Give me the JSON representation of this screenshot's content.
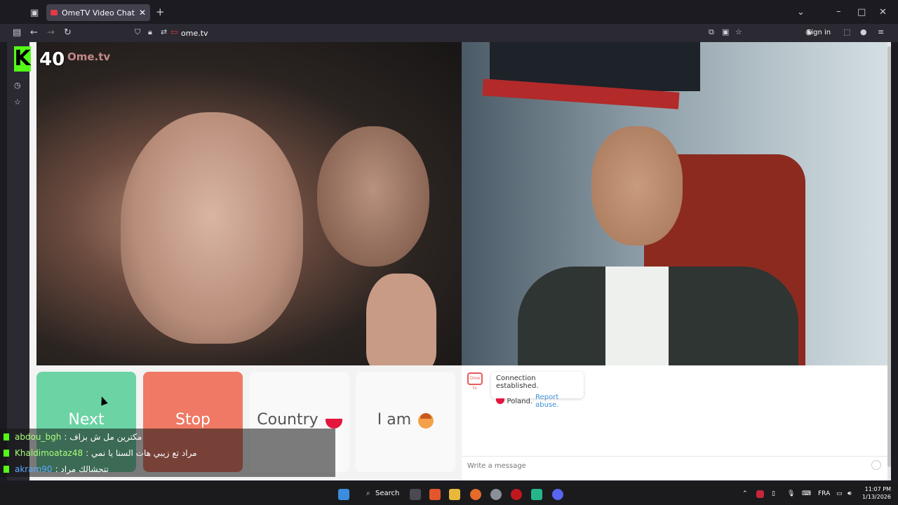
{
  "browser": {
    "tab_title": "OmeTV Video Chat — Ome",
    "tab_close": "✕",
    "new_tab": "+",
    "url": "ome.tv",
    "sign_in": "Sign in"
  },
  "stream": {
    "viewer_count": "40",
    "site_logo": "Ome.tv"
  },
  "buttons": {
    "next": "Next",
    "stop": "Stop",
    "country": "Country",
    "i_am": "I am"
  },
  "chat": {
    "logo": "Ome tv",
    "system_line1": "Connection established.",
    "country": "Poland.",
    "report": "Report abuse.",
    "input_placeholder": "Write a message"
  },
  "overlay": [
    {
      "user": "abdou_bgh",
      "text": ": مكترين مل ش بزاف"
    },
    {
      "user": "Khaldimoataz48",
      "text": ": مراد تع زيبي هات السنا يا نمي"
    },
    {
      "user": "akram90",
      "text": ": تتحشالك مراد"
    }
  ],
  "taskbar": {
    "search": "Search",
    "lang": "FRA",
    "time": "11:07 PM",
    "date": "1/13/2026"
  },
  "colors": {
    "next": "#6cd3a4",
    "stop": "#ef7964",
    "kick_green": "#53fc18"
  }
}
